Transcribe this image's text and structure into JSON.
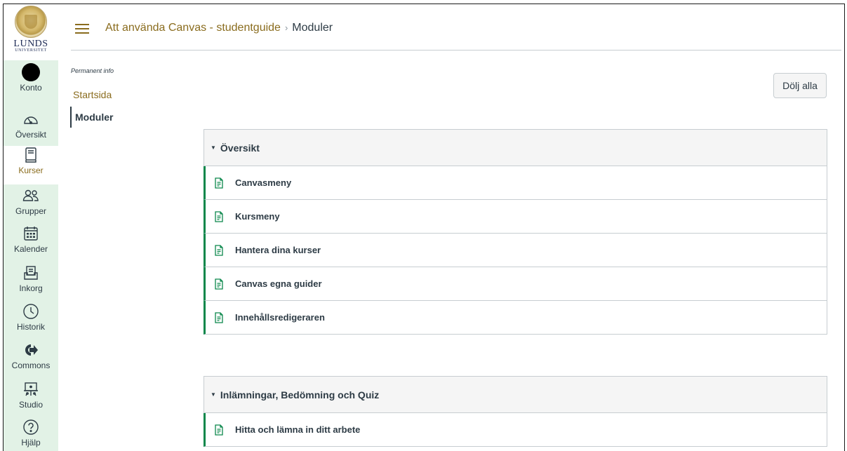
{
  "global_nav": {
    "logo": {
      "name": "LUNDS",
      "sub": "UNIVERSITET"
    },
    "items": [
      {
        "label": "Konto",
        "icon": "avatar"
      },
      {
        "label": "Översikt",
        "icon": "dashboard-gauge-icon"
      },
      {
        "label": "Kurser",
        "icon": "courses-book-icon"
      },
      {
        "label": "Grupper",
        "icon": "groups-people-icon"
      },
      {
        "label": "Kalender",
        "icon": "calendar-icon"
      },
      {
        "label": "Inkorg",
        "icon": "inbox-icon"
      },
      {
        "label": "Historik",
        "icon": "history-clock-icon"
      },
      {
        "label": "Commons",
        "icon": "commons-arrow-icon"
      },
      {
        "label": "Studio",
        "icon": "studio-presentation-icon"
      },
      {
        "label": "Hjälp",
        "icon": "help-question-icon"
      }
    ]
  },
  "breadcrumb": {
    "course": "Att använda Canvas - studentguide",
    "separator": "›",
    "current": "Moduler"
  },
  "course_nav": {
    "info": "Permanent info",
    "items": [
      {
        "label": "Startsida"
      },
      {
        "label": "Moduler"
      }
    ]
  },
  "actions": {
    "collapse_all": "Dölj alla"
  },
  "modules": [
    {
      "title": "Översikt",
      "items": [
        "Canvasmeny",
        "Kursmeny",
        "Hantera dina kurser",
        "Canvas egna guider",
        "Innehållsredigeraren"
      ]
    },
    {
      "title": "Inlämningar, Bedömning och Quiz",
      "items": [
        "Hitta och lämna in ditt arbete"
      ]
    }
  ],
  "colors": {
    "nav_bg": "#e2f2e6",
    "link": "#8a6c1e",
    "published_green": "#0b874b",
    "text": "#2d3b45"
  }
}
